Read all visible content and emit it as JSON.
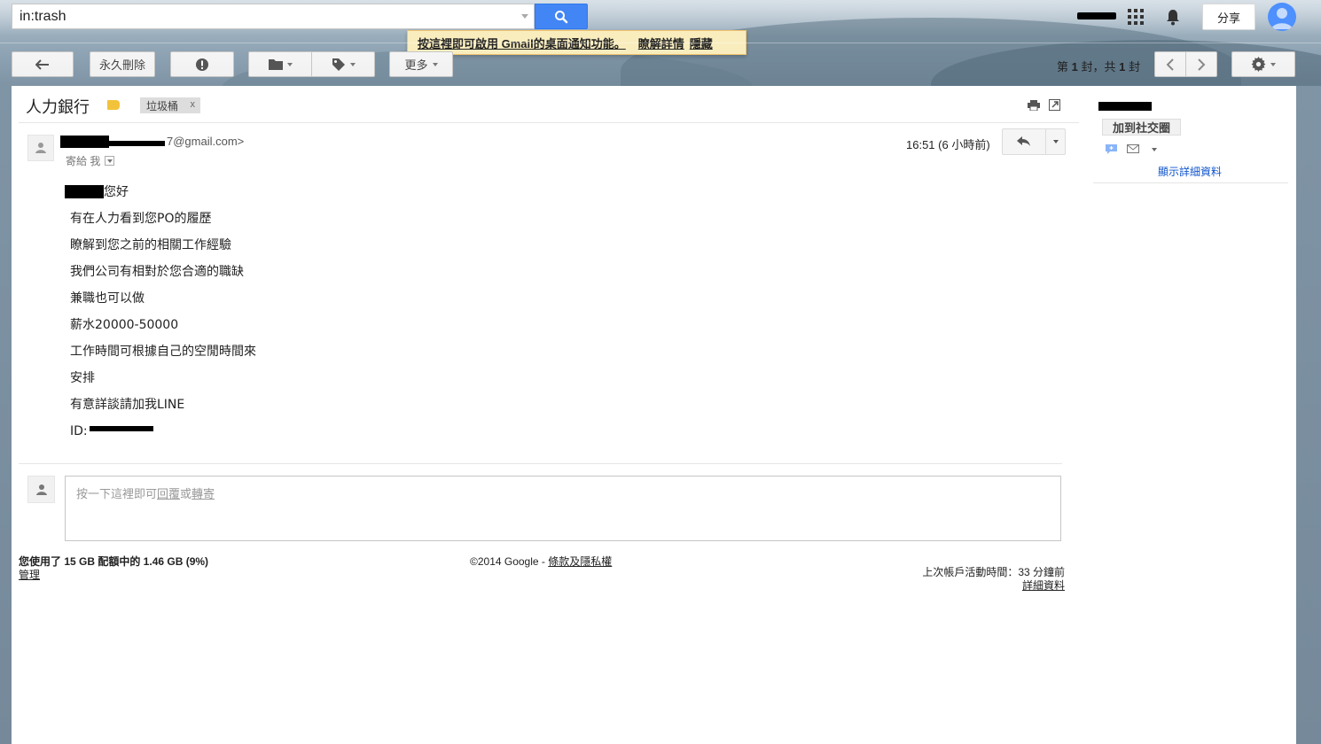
{
  "search": {
    "query": "in:trash"
  },
  "notification": {
    "text": "按這裡即可啟用 Gmail的桌面通知功能。",
    "learn_more": "瞭解詳情",
    "hide": "隱藏"
  },
  "header": {
    "share_label": "分享"
  },
  "toolbar": {
    "delete_forever_label": "永久刪除",
    "more_label": "更多",
    "pager": {
      "prefix": "第",
      "current": "1",
      "mid": "封，共",
      "total": "1",
      "suffix": "封"
    }
  },
  "message": {
    "subject": "人力銀行",
    "label_chip": "垃圾桶",
    "label_chip_close": "x",
    "from_suffix": "7@gmail.com>",
    "to": "寄給 我",
    "date": "16:51 (6 小時前)",
    "body": [
      "您好",
      "有在人力看到您PO的履歷",
      "瞭解到您之前的相關工作經驗",
      "我們公司有相對於您合適的職缺",
      "兼職也可以做",
      "薪水20000-50000",
      "工作時間可根據自己的空閒時間來",
      "安排",
      "有意詳談請加我LINE",
      "ID:"
    ]
  },
  "reply": {
    "prefix": "按一下這裡即可",
    "reply_link": "回覆",
    "or": "或",
    "forward_link": "轉寄"
  },
  "footer": {
    "quota": "您使用了 15 GB 配額中的 1.46 GB (9%)",
    "manage": "管理",
    "copyright": "©2014 Google - ",
    "terms": "條款及隱私權",
    "last_activity": "上次帳戶活動時間：33 分鐘前",
    "details": "詳細資料"
  },
  "side_panel": {
    "add_to_circles": "加到社交圈",
    "show_details": "顯示詳細資料"
  }
}
